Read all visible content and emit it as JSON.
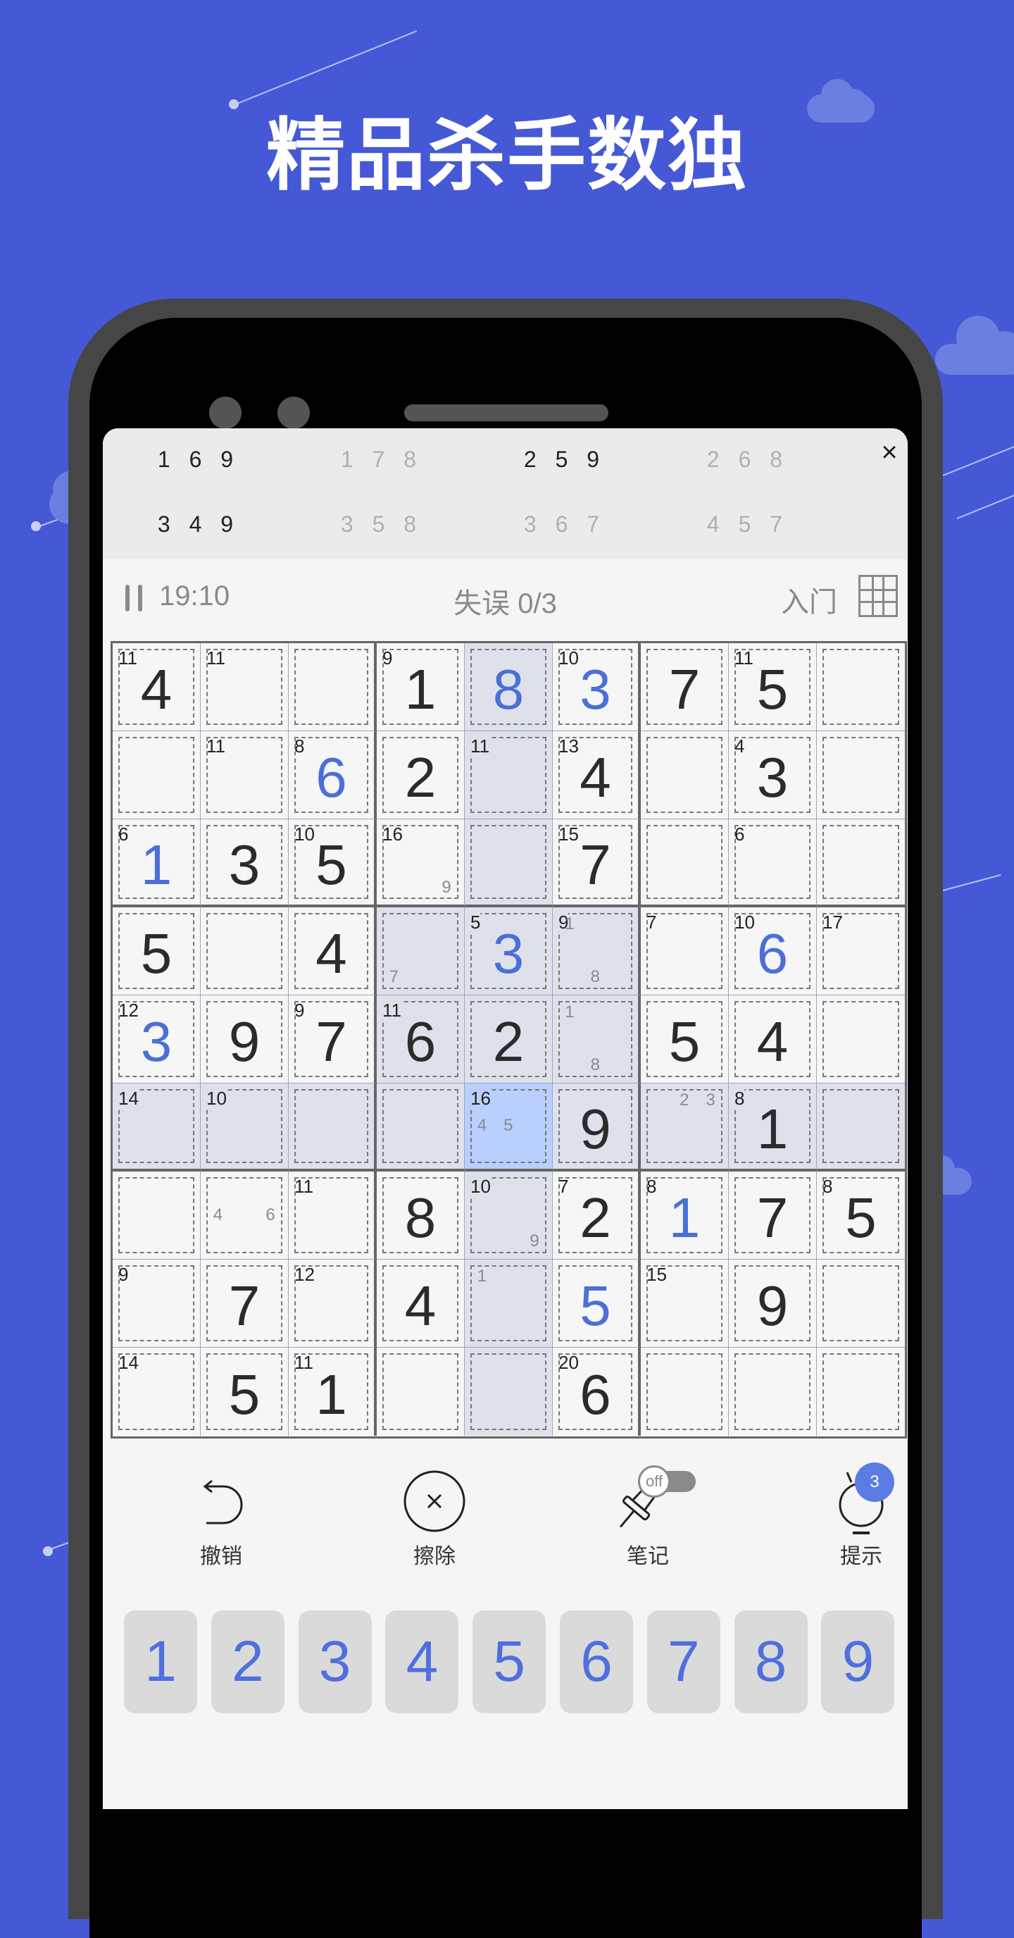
{
  "headline": "精品杀手数独",
  "combinations": [
    {
      "text": "1 6 9",
      "active": true
    },
    {
      "text": "1 7 8",
      "active": false
    },
    {
      "text": "2 5 9",
      "active": true
    },
    {
      "text": "2 6 8",
      "active": false
    },
    {
      "text": "3 4 9",
      "active": true
    },
    {
      "text": "3 5 8",
      "active": false
    },
    {
      "text": "3 6 7",
      "active": false
    },
    {
      "text": "4 5 7",
      "active": false
    }
  ],
  "close_icon": "×",
  "status": {
    "timer": "19:10",
    "mistakes": "失误 0/3",
    "level": "入门"
  },
  "board": {
    "values": [
      [
        4,
        0,
        0,
        1,
        8,
        3,
        7,
        5,
        0
      ],
      [
        0,
        0,
        6,
        2,
        0,
        4,
        0,
        3,
        0
      ],
      [
        1,
        3,
        5,
        0,
        0,
        7,
        0,
        0,
        0
      ],
      [
        5,
        0,
        4,
        0,
        3,
        0,
        0,
        6,
        0
      ],
      [
        3,
        9,
        7,
        6,
        2,
        0,
        5,
        4,
        0
      ],
      [
        0,
        0,
        0,
        0,
        0,
        9,
        0,
        1,
        0
      ],
      [
        0,
        0,
        0,
        8,
        0,
        2,
        1,
        7,
        5
      ],
      [
        0,
        7,
        0,
        4,
        0,
        5,
        0,
        9,
        0
      ],
      [
        0,
        5,
        1,
        0,
        0,
        6,
        0,
        0,
        0
      ]
    ],
    "user_entered": [
      [
        0,
        0,
        0,
        0,
        1,
        1,
        0,
        0,
        0
      ],
      [
        0,
        0,
        1,
        0,
        0,
        0,
        0,
        0,
        0
      ],
      [
        1,
        0,
        0,
        0,
        0,
        0,
        0,
        0,
        0
      ],
      [
        0,
        0,
        0,
        0,
        1,
        0,
        0,
        1,
        0
      ],
      [
        1,
        0,
        0,
        0,
        0,
        0,
        0,
        0,
        0
      ],
      [
        0,
        0,
        0,
        0,
        0,
        0,
        0,
        0,
        0
      ],
      [
        0,
        0,
        0,
        0,
        0,
        0,
        1,
        0,
        0
      ],
      [
        0,
        0,
        0,
        0,
        0,
        1,
        0,
        0,
        0
      ],
      [
        0,
        0,
        0,
        0,
        0,
        0,
        0,
        0,
        0
      ]
    ],
    "cage_sums": [
      [
        "11",
        "11",
        "",
        "9",
        "",
        "10",
        "",
        "11",
        ""
      ],
      [
        "",
        "11",
        "8",
        "",
        "11",
        "13",
        "",
        "4",
        ""
      ],
      [
        "6",
        "",
        "10",
        "16",
        "",
        "15",
        "",
        "6",
        ""
      ],
      [
        "",
        "",
        "",
        "",
        "5",
        "9",
        "7",
        "10",
        "17"
      ],
      [
        "12",
        "",
        "9",
        "11",
        "",
        "",
        "",
        "",
        ""
      ],
      [
        "14",
        "10",
        "",
        "",
        "16",
        "",
        "",
        "8",
        ""
      ],
      [
        "",
        "",
        "11",
        "",
        "10",
        "7",
        "8",
        "",
        "8"
      ],
      [
        "9",
        "",
        "12",
        "",
        "",
        "",
        "15",
        "",
        ""
      ],
      [
        "14",
        "",
        "11",
        "",
        "",
        "20",
        "",
        "",
        ""
      ]
    ],
    "notes": [
      {
        "row": 2,
        "col": 3,
        "digits": [
          9
        ]
      },
      {
        "row": 3,
        "col": 3,
        "digits": [
          7
        ]
      },
      {
        "row": 3,
        "col": 5,
        "digits": [
          1,
          8
        ]
      },
      {
        "row": 4,
        "col": 5,
        "digits": [
          1,
          8
        ]
      },
      {
        "row": 5,
        "col": 4,
        "digits": [
          4,
          5
        ]
      },
      {
        "row": 5,
        "col": 6,
        "digits": [
          2,
          3
        ]
      },
      {
        "row": 6,
        "col": 1,
        "digits": [
          4,
          6
        ]
      },
      {
        "row": 6,
        "col": 4,
        "digits": [
          9
        ]
      },
      {
        "row": 7,
        "col": 4,
        "digits": [
          1
        ]
      }
    ],
    "selected": {
      "row": 5,
      "col": 4
    }
  },
  "tools": [
    {
      "label": "撤销",
      "icon": "undo-icon"
    },
    {
      "label": "擦除",
      "icon": "erase-icon"
    },
    {
      "label": "笔记",
      "icon": "pencil-icon",
      "toggle": "off"
    },
    {
      "label": "提示",
      "icon": "hint-bulb-icon",
      "badge": "3"
    }
  ],
  "numpad": [
    "1",
    "2",
    "3",
    "4",
    "5",
    "6",
    "7",
    "8",
    "9"
  ],
  "colors": {
    "background": "#4559d6",
    "accent": "#4f6fde",
    "selected_cell": "#b9cffd",
    "highlight_cell": "#dfe1ea"
  }
}
